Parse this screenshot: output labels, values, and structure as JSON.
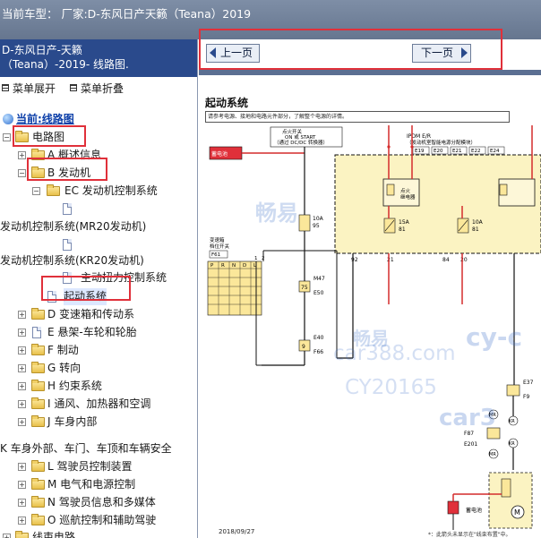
{
  "window": {
    "title": "当前车型： 厂家:D-东风日产天籁（Teana）2019"
  },
  "left_panel": {
    "header_line1": "D-东风日产-天籁",
    "header_line2": "（Teana）-2019- 线路图.",
    "expand_menu": "菜单展开",
    "collapse_menu": "菜单折叠",
    "tree": [
      {
        "label": "当前:线路图",
        "type": "current"
      },
      {
        "label": "电路图",
        "type": "folder-open"
      },
      {
        "label": "A 概述信息",
        "type": "folder"
      },
      {
        "label": "B 发动机",
        "type": "folder-open"
      },
      {
        "label": "EC 发动机控制系统",
        "type": "folder-open"
      },
      {
        "label": "",
        "type": "page"
      },
      {
        "label": "发动机控制系统(MR20发动机)",
        "type": "text"
      },
      {
        "label": "",
        "type": "page"
      },
      {
        "label": "发动机控制系统(KR20发动机)",
        "type": "text"
      },
      {
        "label": "主动扭力控制系统",
        "type": "page"
      },
      {
        "label": "起动系统",
        "type": "page-selected"
      },
      {
        "label": "D 变速箱和传动系",
        "type": "folder"
      },
      {
        "label": "E 悬架-车轮和轮胎",
        "type": "page"
      },
      {
        "label": "F 制动",
        "type": "folder"
      },
      {
        "label": "G 转向",
        "type": "folder"
      },
      {
        "label": "H 约束系统",
        "type": "folder"
      },
      {
        "label": "I 通风、加热器和空调",
        "type": "folder"
      },
      {
        "label": "J 车身内部",
        "type": "folder"
      },
      {
        "label": "K 车身外部、车门、车顶和车辆安全",
        "type": "text"
      },
      {
        "label": "L 驾驶员控制装置",
        "type": "folder"
      },
      {
        "label": "M 电气和电源控制",
        "type": "folder"
      },
      {
        "label": "N 驾驶员信息和多媒体",
        "type": "folder"
      },
      {
        "label": "O 巡航控制和辅助驾驶",
        "type": "folder"
      },
      {
        "label": "线束电路",
        "type": "folder"
      }
    ]
  },
  "toolbar": {
    "prev_label": "上一页",
    "next_label": "下一页"
  },
  "content": {
    "section_title": "起动系统",
    "section_desc": "请参考电源、接地和电路元件部分，了解整个电源的详情。",
    "date": "2018/09/27",
    "footnote": "*：此箭头未显示在\"线束布置\"中。",
    "labels": {
      "battery_top": "蓄电池",
      "ignition_switch_l1": "点火开关",
      "ignition_switch_l2": "ON 或 START",
      "ignition_switch_l3": "（通过 DC/DC 转换器）",
      "fuse_10a_a": "10A",
      "fuse_10a_a_no": "95",
      "conn_m47": "M47",
      "conn_e50": "E50",
      "pin_75": "75",
      "pin_9": "9",
      "conn_e40": "E40",
      "conn_f66": "F66",
      "ipdm_l1": "IPDM E/R",
      "ipdm_l2": "（发动机室智能电源分配模块）",
      "conn_e19": "E19",
      "conn_e20": "E20",
      "conn_e21": "E21",
      "conn_e22": "E22",
      "conn_e24": "E24",
      "ign_relay_l1": "点火",
      "ign_relay_l2": "继电器",
      "fuse_15a": "15A",
      "fuse_15a_no": "81",
      "fuse_10a_b": "10A",
      "fuse_10a_b_no": "81",
      "pin_92": "92",
      "pin_21": "21",
      "pin_84": "84",
      "pin_20": "20",
      "trans_l1": "变速箱",
      "trans_l2": "档位开关",
      "conn_f61": "F61",
      "trans_positions": [
        "P",
        "R",
        "N",
        "D",
        "L"
      ],
      "pin_1": "1",
      "pin_2": "2",
      "conn_e37": "E37",
      "conn_f9": "F9",
      "conn_f87": "F87",
      "conn_e201": "E201",
      "mr_a": "MR",
      "kr_a": "KR",
      "mr_b": "MR",
      "kr_b": "KR",
      "battery_bottom": "蓄电池",
      "motor": "M"
    }
  },
  "watermarks": {
    "w1": "畅易",
    "w2": "畅易",
    "w3": "car388.com",
    "w4": "CY20165",
    "w5": "car3",
    "w6": "cy-c"
  },
  "colors": {
    "title_bar": "#6f7f98",
    "left_header": "#2a4a8c",
    "highlight_red": "#e0303a",
    "wire_red": "#d42c2c",
    "wire_black": "#111111",
    "ipdm_fill": "#fbf3c2",
    "current_link": "#0b3ea8"
  }
}
